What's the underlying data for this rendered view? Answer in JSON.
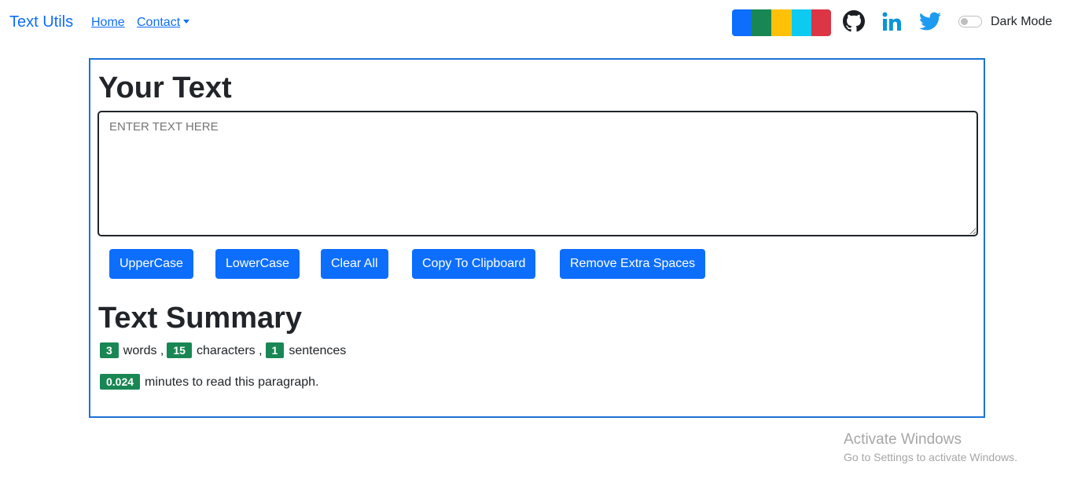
{
  "navbar": {
    "brand": "Text Utils",
    "links": [
      {
        "label": "Home"
      },
      {
        "label": "Contact"
      }
    ],
    "theme_swatches": [
      "#0d6efd",
      "#198754",
      "#ffc107",
      "#0dcaf0",
      "#dc3545"
    ],
    "social_icons": [
      "github-icon",
      "linkedin-icon",
      "twitter-icon"
    ],
    "dark_mode_label": "Dark Mode",
    "dark_mode_on": false
  },
  "main": {
    "heading": "Your Text",
    "textarea": {
      "value": "",
      "placeholder": "ENTER TEXT HERE"
    },
    "buttons": [
      "UpperCase",
      "LowerCase",
      "Clear All",
      "Copy To Clipboard",
      "Remove Extra Spaces"
    ],
    "summary_heading": "Text Summary",
    "summary": {
      "words": "3",
      "words_label": "words ,",
      "characters": "15",
      "characters_label": "characters ,",
      "sentences": "1",
      "sentences_label": "sentences",
      "minutes": "0.024",
      "minutes_label": "minutes to read this paragraph."
    }
  },
  "watermark": {
    "title": "Activate Windows",
    "subtitle": "Go to Settings to activate Windows."
  },
  "colors": {
    "accent": "#0d6efd",
    "badge": "#198754",
    "card_border": "#1a73d6"
  }
}
